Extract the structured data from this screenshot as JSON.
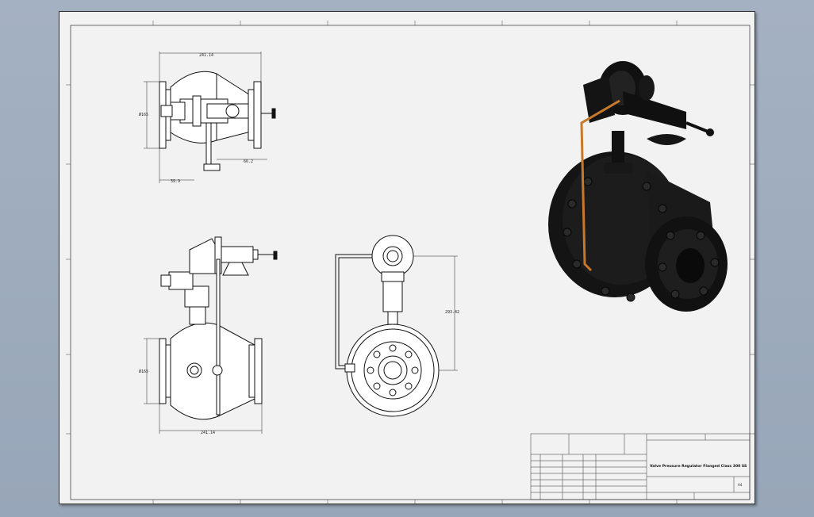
{
  "sheet": {
    "background": "#f2f2f2",
    "line_color": "#111111",
    "pipe_color": "#c8782a"
  },
  "views": {
    "top_view": {
      "dim_overall_width": "241.14",
      "dim_flange_diameter": "Ø165",
      "dim_handle_offset": "66.2",
      "dim_left_offset": "39.9"
    },
    "front_view": {
      "dim_flange_diameter": "Ø165",
      "dim_overall_width": "241.14"
    },
    "side_view": {
      "dim_height": "293.42"
    },
    "iso_view": {
      "label": ""
    }
  },
  "title_block": {
    "title": "Valve Pressure Regulator Flanged Class 300 SS",
    "sheet_size": "A4",
    "scale_label": "",
    "material_placeholder": "",
    "drawn_by": ""
  }
}
